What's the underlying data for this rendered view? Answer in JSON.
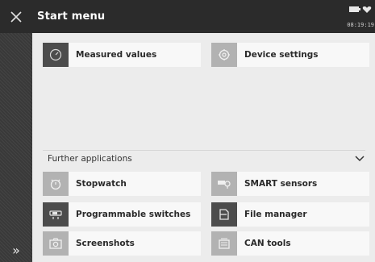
{
  "header": {
    "title": "Start menu",
    "time": "08:19:19",
    "icons": [
      "close-icon",
      "battery-icon",
      "heart-icon"
    ]
  },
  "sidebar": {
    "expand_label": "»"
  },
  "main": {
    "tiles": [
      {
        "label": "Measured values",
        "icon": "gauge-icon"
      },
      {
        "label": "Device settings",
        "icon": "settings-icon"
      }
    ],
    "further_section": {
      "title": "Further applications",
      "icon": "chevron-down-icon",
      "tiles": [
        {
          "label": "Stopwatch",
          "icon": "stopwatch-icon"
        },
        {
          "label": "SMART sensors",
          "icon": "sensor-icon"
        },
        {
          "label": "Programmable switches",
          "icon": "switch-icon"
        },
        {
          "label": "File manager",
          "icon": "folder-icon"
        },
        {
          "label": "Screenshots",
          "icon": "camera-icon"
        },
        {
          "label": "CAN tools",
          "icon": "can-bus-icon"
        }
      ]
    }
  }
}
